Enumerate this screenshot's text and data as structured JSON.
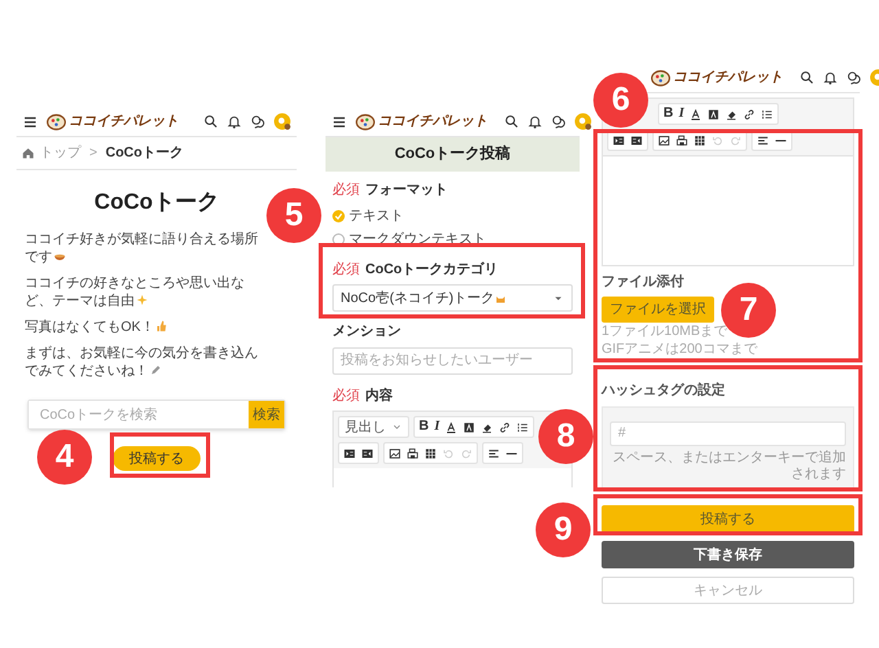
{
  "screens": [
    {
      "header": {
        "logo": "ココイチパレット"
      },
      "breadcrumb": [
        "トップ",
        "CoCoトーク"
      ],
      "breadcrumb_separator": ">",
      "title": "CoCoトーク",
      "paragraphs": [
        {
          "text": "ココイチ好きが気軽に語り合える場所です"
        },
        {
          "text": "ココイチの好きなところや思い出など、テーマは自由"
        },
        {
          "text": "写真はなくてもOK！"
        },
        {
          "text": "まずは、お気軽に今の気分を書き込んでみてくださいね！"
        }
      ],
      "search": {
        "placeholder": "CoCoトークを検索",
        "button": "検索"
      },
      "post_button": "投稿する"
    },
    {
      "header": {
        "logo": "ココイチパレット"
      },
      "title": "CoCoトーク投稿",
      "format": {
        "required": "必須",
        "label": "フォーマット",
        "options": [
          {
            "label": "テキスト",
            "selected": true
          },
          {
            "label": "マークダウンテキスト",
            "selected": false
          }
        ]
      },
      "category": {
        "required": "必須",
        "label": "CoCoトークカテゴリ",
        "value": "NoCo壱(ネコイチ)トーク"
      },
      "mention": {
        "label": "メンション",
        "placeholder": "投稿をお知らせしたいユーザー"
      },
      "content": {
        "required": "必須",
        "label": "内容",
        "heading_select": "見出し",
        "bold": "B",
        "italic": "I"
      }
    },
    {
      "header": {
        "logo": "ココイチパレット"
      },
      "toolbar": {
        "bold": "B",
        "italic": "I"
      },
      "file": {
        "label": "ファイル添付",
        "button": "ファイルを選択",
        "notes": [
          "1ファイル10MBまで",
          "GIFアニメは200コマまで"
        ]
      },
      "hashtag": {
        "label": "ハッシュタグの設定",
        "placeholder": "#",
        "hint": "スペース、またはエンターキーで追加されます"
      },
      "buttons": [
        {
          "label": "投稿する",
          "kind": "primary"
        },
        {
          "label": "下書き保存",
          "kind": "dark"
        },
        {
          "label": "キャンセル",
          "kind": "outline"
        }
      ]
    }
  ],
  "callouts": [
    "4",
    "5",
    "6",
    "7",
    "8",
    "9"
  ]
}
